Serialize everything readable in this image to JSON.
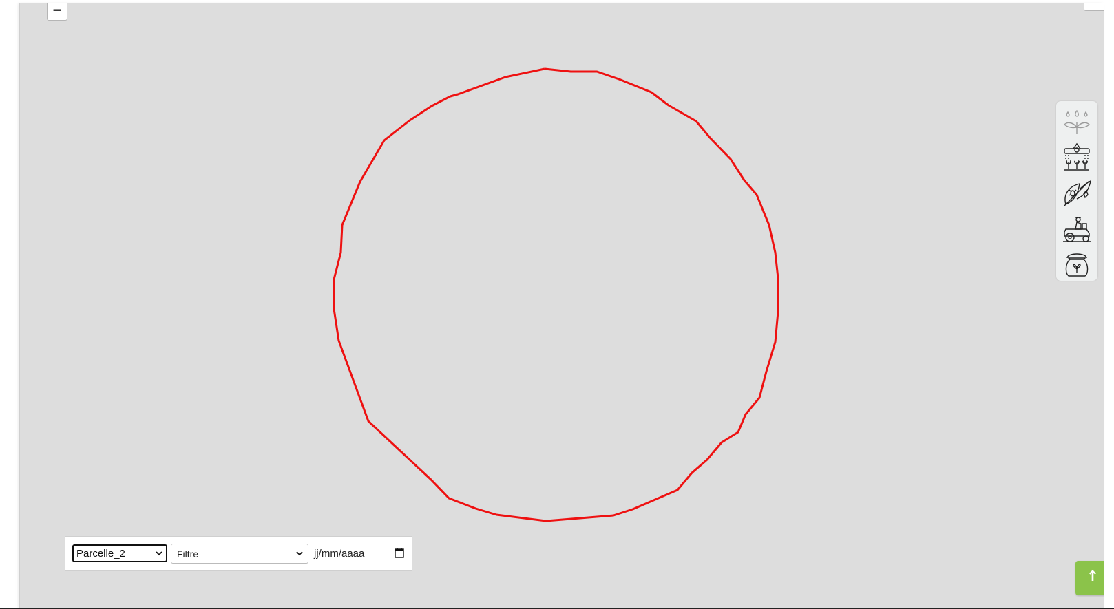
{
  "map": {
    "zoom_out_label": "−",
    "parcel_outline_color": "#ee1111",
    "background_color": "#dddddd"
  },
  "tools": [
    {
      "icon": "irrigation-plant-icon"
    },
    {
      "icon": "sprinkler-crops-icon"
    },
    {
      "icon": "no-pesticide-icon"
    },
    {
      "icon": "farmer-tractor-icon"
    },
    {
      "icon": "seed-bag-icon"
    }
  ],
  "filters": {
    "parcel_selected": "Parcelle_2",
    "filter_selected": "Filtre",
    "date_placeholder": "jj/mm/aaaa"
  },
  "scroll_top": {
    "label": "↑",
    "color": "#8bc34a"
  }
}
